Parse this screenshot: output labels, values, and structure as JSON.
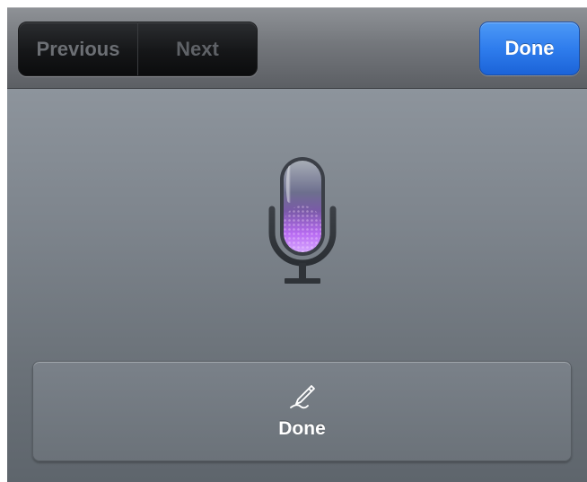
{
  "toolbar": {
    "previous_label": "Previous",
    "next_label": "Next",
    "done_label": "Done"
  },
  "dictation": {
    "done_label": "Done",
    "mic_icon": "microphone-icon",
    "pen_icon": "pen-icon"
  },
  "colors": {
    "accent": "#2f7ded",
    "mic_glow": "#b06bf0"
  }
}
